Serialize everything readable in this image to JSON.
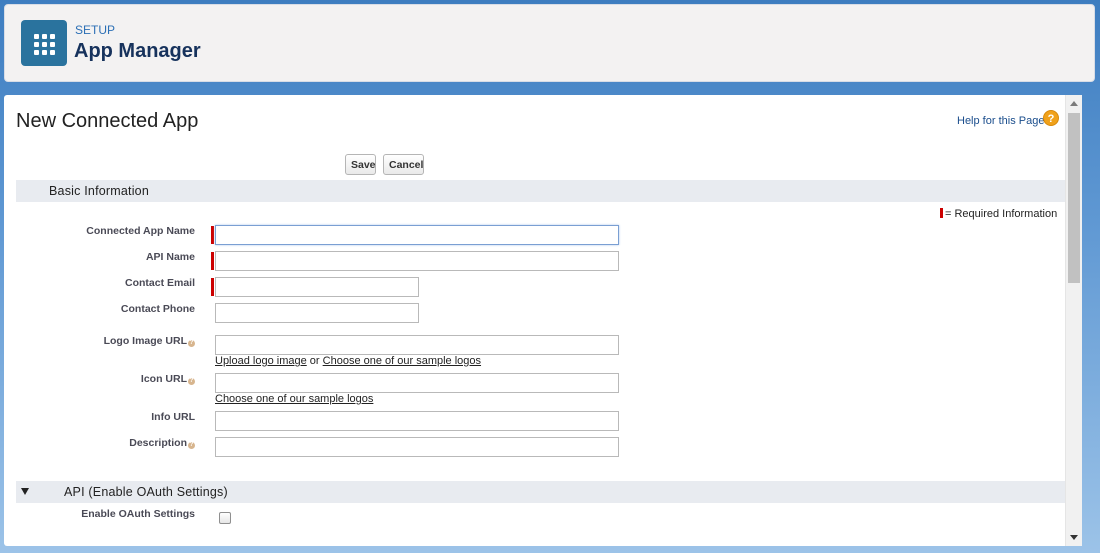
{
  "header": {
    "setup_label": "SETUP",
    "app_title": "App Manager",
    "icon": "app-grid-icon"
  },
  "page": {
    "title": "New Connected App",
    "help_link": "Help for this Page",
    "help_icon": "?"
  },
  "buttons": {
    "save": "Save",
    "cancel": "Cancel"
  },
  "sections": {
    "basic": "Basic Information",
    "api": "API (Enable OAuth Settings)"
  },
  "required_legend": "= Required Information",
  "fields": {
    "connected_app_name": {
      "label": "Connected App Name",
      "value": ""
    },
    "api_name": {
      "label": "API Name",
      "value": ""
    },
    "contact_email": {
      "label": "Contact Email",
      "value": ""
    },
    "contact_phone": {
      "label": "Contact Phone",
      "value": ""
    },
    "logo_image_url": {
      "label": "Logo Image URL",
      "value": ""
    },
    "icon_url": {
      "label": "Icon URL",
      "value": ""
    },
    "info_url": {
      "label": "Info URL",
      "value": ""
    },
    "description": {
      "label": "Description",
      "value": ""
    },
    "enable_oauth": {
      "label": "Enable OAuth Settings",
      "checked": false
    }
  },
  "links": {
    "upload_logo": "Upload logo image",
    "or": "or",
    "choose_sample_logos": "Choose one of our sample logos",
    "choose_sample_logos_icon": "Choose one of our sample logos"
  },
  "colors": {
    "required": "#cc0000",
    "header_icon_bg": "#2a739e",
    "section_bg": "#e8ebf0"
  }
}
